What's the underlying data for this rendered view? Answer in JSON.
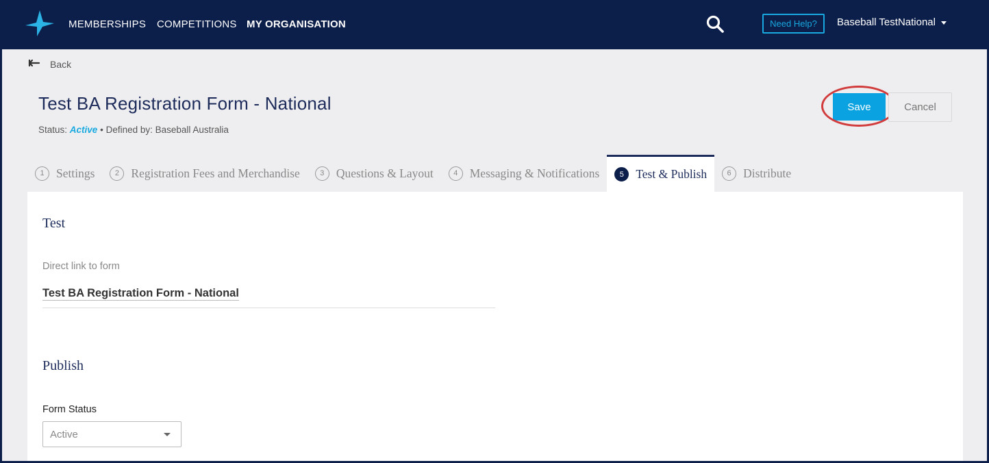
{
  "topbar": {
    "nav": [
      {
        "label": "MEMBERSHIPS"
      },
      {
        "label": "COMPETITIONS"
      },
      {
        "label": "MY ORGANISATION"
      }
    ],
    "help_label": "Need Help?",
    "user_name": "Baseball TestNational"
  },
  "page": {
    "back_label": "Back",
    "title": "Test BA Registration Form - National",
    "status_prefix": "Status:",
    "status_value": "Active",
    "defined_by": "• Defined by: Baseball Australia",
    "save_label": "Save",
    "cancel_label": "Cancel"
  },
  "tabs": [
    {
      "num": "1",
      "label": "Settings"
    },
    {
      "num": "2",
      "label": "Registration Fees and Merchandise"
    },
    {
      "num": "3",
      "label": "Questions & Layout"
    },
    {
      "num": "4",
      "label": "Messaging & Notifications"
    },
    {
      "num": "5",
      "label": "Test & Publish"
    },
    {
      "num": "6",
      "label": "Distribute"
    }
  ],
  "test_section": {
    "title": "Test",
    "link_label": "Direct link to form",
    "link_text": "Test BA Registration Form - National"
  },
  "publish_section": {
    "title": "Publish",
    "status_label": "Form Status",
    "status_selected": "Active"
  },
  "colors": {
    "navy": "#0c1e4a",
    "accent": "#0aa2e0",
    "highlight": "#d23b3b"
  }
}
